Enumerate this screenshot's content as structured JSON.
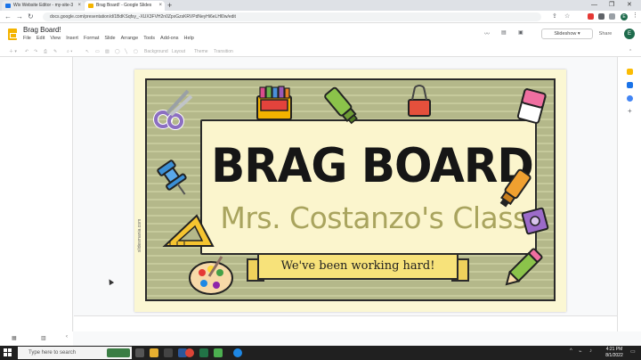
{
  "browser": {
    "tabs": [
      {
        "title": "Wix Website Editor - my-site-3",
        "favicon_color": "#1a73e8"
      },
      {
        "title": "Brag Board! - Google Slides",
        "favicon_color": "#f4b400"
      }
    ],
    "new_tab": "+",
    "url": "docs.google.com/presentation/d/1BdKSqfsy_-XUX3FVH2n0ZpxGzsKRVPdNeyHi6eLHl0w/edit",
    "profile_initial": "E"
  },
  "document": {
    "title": "Brag Board!",
    "menu": [
      "File",
      "Edit",
      "View",
      "Insert",
      "Format",
      "Slide",
      "Arrange",
      "Tools",
      "Add-ons",
      "Help"
    ],
    "slideshow_label": "Slideshow",
    "share_label": "Share",
    "avatar_initial": "E"
  },
  "toolbar": {
    "items": [
      "Background",
      "Layout",
      "Theme",
      "Transition"
    ]
  },
  "slide": {
    "title": "BRAG BOARD",
    "subtitle": "Mrs. Costanzo's Class",
    "banner": "We've been working hard!",
    "watermark": "slidesmania.com"
  },
  "taskbar": {
    "search_placeholder": "Type here to search",
    "time": "4:21 PM",
    "date": "8/1/2022"
  }
}
